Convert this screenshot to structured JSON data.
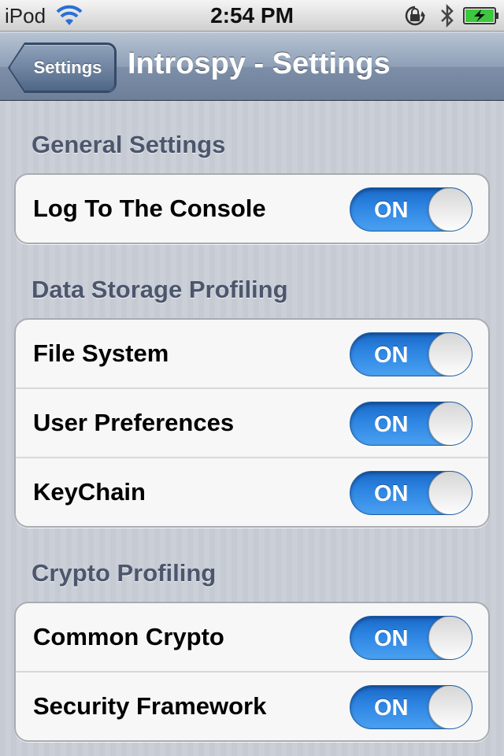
{
  "status_bar": {
    "carrier": "iPod",
    "time": "2:54 PM",
    "icons": [
      "wifi-icon",
      "rotation-lock-icon",
      "bluetooth-icon",
      "battery-charging-icon"
    ]
  },
  "nav": {
    "back_label": "Settings",
    "title": "Introspy - Settings"
  },
  "sections": [
    {
      "header": "General Settings",
      "rows": [
        {
          "label": "Log To The Console",
          "toggle": "ON"
        }
      ]
    },
    {
      "header": "Data Storage Profiling",
      "rows": [
        {
          "label": "File System",
          "toggle": "ON"
        },
        {
          "label": "User Preferences",
          "toggle": "ON"
        },
        {
          "label": "KeyChain",
          "toggle": "ON"
        }
      ]
    },
    {
      "header": "Crypto Profiling",
      "rows": [
        {
          "label": "Common Crypto",
          "toggle": "ON"
        },
        {
          "label": "Security Framework",
          "toggle": "ON"
        }
      ]
    }
  ],
  "colors": {
    "toggle_on": "#2e86e3",
    "nav_bar": "#8e9fb6",
    "section_header": "#4c566c",
    "battery": "#3cc83c"
  }
}
